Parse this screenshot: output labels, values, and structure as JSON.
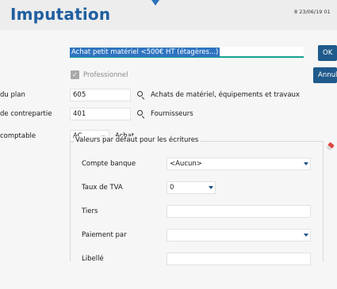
{
  "header": {
    "title": "Imputation",
    "meta": "8  23/06/19 01"
  },
  "form": {
    "description_value": "Achat petit matériel <500€ HT (étagères...)",
    "professionnel_label": "Professionnel",
    "professionnel_checked": true,
    "compte_plan": {
      "label": "du plan",
      "value": "605",
      "description": "Achats de matériel, équipements et travaux"
    },
    "compte_contrepartie": {
      "label": "de contrepartie",
      "value": "401",
      "description": "Fournisseurs"
    },
    "journal": {
      "label": "comptable",
      "value": "AC",
      "description": "Achat"
    }
  },
  "defaults": {
    "title": "Valeurs par défaut pour les écritures",
    "compte_banque": {
      "label": "Compte banque",
      "value": "<Aucun>"
    },
    "taux_tva": {
      "label": "Taux de TVA",
      "value": "0"
    },
    "tiers": {
      "label": "Tiers",
      "value": ""
    },
    "paiement_par": {
      "label": "Paiement par",
      "value": ""
    },
    "libelle": {
      "label": "Libellé",
      "value": ""
    }
  },
  "buttons": {
    "ok": "OK",
    "annuler": "Annuler"
  },
  "colors": {
    "title": "#1f5fa0",
    "button_bg": "#1f5a8c",
    "selection": "#2f74c0",
    "focus_underline": "#17a08e"
  },
  "icons": {
    "search": "search-icon",
    "eraser": "eraser-icon",
    "dropdown": "chevron-down-icon"
  }
}
